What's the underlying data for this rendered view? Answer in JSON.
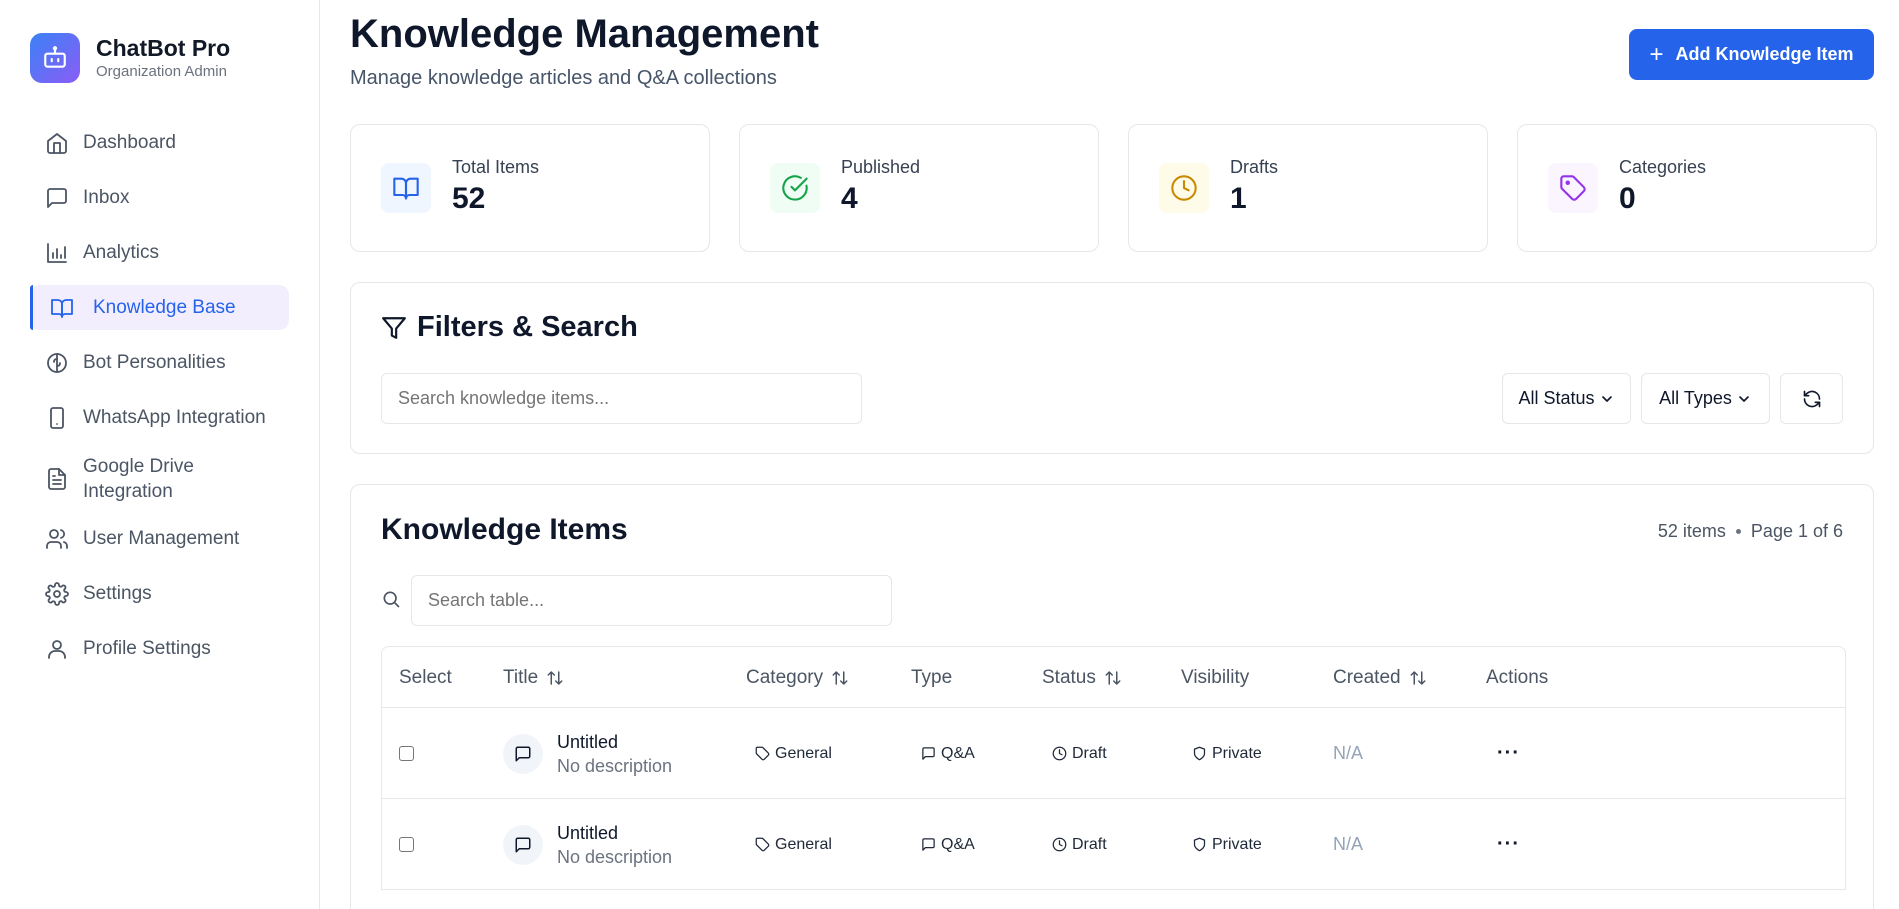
{
  "brand": {
    "name": "ChatBot Pro",
    "subtitle": "Organization Admin",
    "logo_icon": "bot-icon"
  },
  "sidebar": {
    "items": [
      {
        "label": "Dashboard",
        "icon": "home-icon"
      },
      {
        "label": "Inbox",
        "icon": "message-square-icon"
      },
      {
        "label": "Analytics",
        "icon": "bar-chart-icon"
      },
      {
        "label": "Knowledge Base",
        "icon": "book-open-icon",
        "active": true
      },
      {
        "label": "Bot Personalities",
        "icon": "brain-icon"
      },
      {
        "label": "WhatsApp Integration",
        "icon": "smartphone-icon"
      },
      {
        "label": "Google Drive Integration",
        "icon": "file-text-icon"
      },
      {
        "label": "User Management",
        "icon": "users-icon"
      },
      {
        "label": "Settings",
        "icon": "gear-icon"
      },
      {
        "label": "Profile Settings",
        "icon": "user-icon"
      }
    ]
  },
  "header": {
    "title": "Knowledge Management",
    "subtitle": "Manage knowledge articles and Q&A collections",
    "add_button": "Add Knowledge Item"
  },
  "stats": [
    {
      "label": "Total Items",
      "value": "52",
      "icon": "book-open-icon",
      "color": "#2563eb",
      "bg": "#eff6ff"
    },
    {
      "label": "Published",
      "value": "4",
      "icon": "check-circle-icon",
      "color": "#16a34a",
      "bg": "#f0fdf4"
    },
    {
      "label": "Drafts",
      "value": "1",
      "icon": "clock-icon",
      "color": "#ca8a04",
      "bg": "#fefce8"
    },
    {
      "label": "Categories",
      "value": "0",
      "icon": "tag-icon",
      "color": "#9333ea",
      "bg": "#faf5ff"
    }
  ],
  "filters": {
    "title": "Filters & Search",
    "search_placeholder": "Search knowledge items...",
    "status_select": "All Status",
    "type_select": "All Types"
  },
  "items": {
    "title": "Knowledge Items",
    "count_text": "52 items",
    "page_text": "Page 1 of 6",
    "table_search_placeholder": "Search table...",
    "columns": [
      "Select",
      "Title",
      "Category",
      "Type",
      "Status",
      "Visibility",
      "Created",
      "Actions"
    ],
    "rows": [
      {
        "title": "Untitled",
        "description": "No description",
        "category": "General",
        "type": "Q&A",
        "status": "Draft",
        "visibility": "Private",
        "created": "N/A"
      },
      {
        "title": "Untitled",
        "description": "No description",
        "category": "General",
        "type": "Q&A",
        "status": "Draft",
        "visibility": "Private",
        "created": "N/A"
      }
    ]
  },
  "colors": {
    "accent": "#2563eb",
    "active_bg": "#f3eefe",
    "border": "#e5e7eb"
  }
}
